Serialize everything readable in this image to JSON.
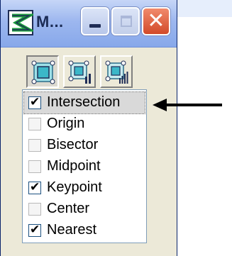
{
  "window": {
    "title": "M...",
    "buttons": {
      "minimize": "minimize-icon",
      "maximize": "maximize-icon",
      "close": "close-icon"
    }
  },
  "toolbar": {
    "tools": [
      {
        "icon": "snap-mode-icon",
        "pressed": true
      },
      {
        "icon": "snap-mode-alt-icon",
        "pressed": false
      },
      {
        "icon": "snap-mode-bars-icon",
        "pressed": false
      }
    ]
  },
  "snap_list": {
    "items": [
      {
        "label": "Intersection",
        "checked": true,
        "selected": true
      },
      {
        "label": "Origin",
        "checked": false,
        "selected": false
      },
      {
        "label": "Bisector",
        "checked": false,
        "selected": false
      },
      {
        "label": "Midpoint",
        "checked": false,
        "selected": false
      },
      {
        "label": "Keypoint",
        "checked": true,
        "selected": false
      },
      {
        "label": "Center",
        "checked": false,
        "selected": false
      },
      {
        "label": "Nearest",
        "checked": true,
        "selected": false
      }
    ]
  },
  "check_glyph": "✔",
  "colors": {
    "titlebar": "#9db7ef",
    "close_button": "#d24a2a",
    "list_border": "#7f9db9"
  }
}
